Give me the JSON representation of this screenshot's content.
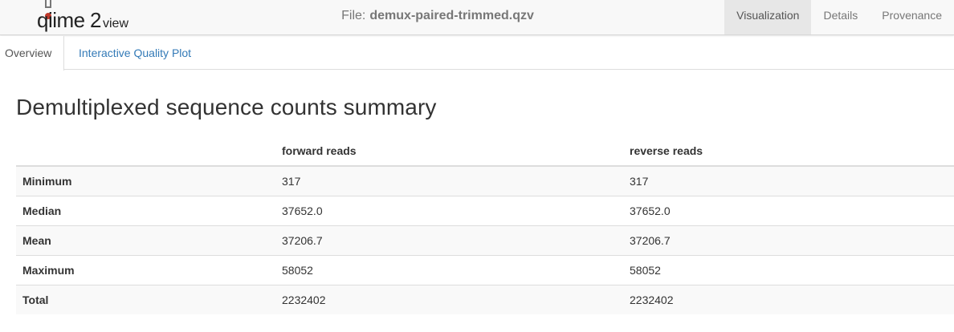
{
  "navbar": {
    "logo_text": "qiime2view",
    "file_label": "File:",
    "file_name": "demux-paired-trimmed.qzv",
    "tabs": [
      "Visualization",
      "Details",
      "Provenance"
    ],
    "active_tab": "Visualization"
  },
  "subtabs": {
    "items": [
      "Overview",
      "Interactive Quality Plot"
    ],
    "active": "Overview"
  },
  "main": {
    "heading": "Demultiplexed sequence counts summary",
    "table": {
      "columns": [
        "",
        "forward reads",
        "reverse reads"
      ],
      "rows": [
        {
          "label": "Minimum",
          "forward": "317",
          "reverse": "317"
        },
        {
          "label": "Median",
          "forward": "37652.0",
          "reverse": "37652.0"
        },
        {
          "label": "Mean",
          "forward": "37206.7",
          "reverse": "37206.7"
        },
        {
          "label": "Maximum",
          "forward": "58052",
          "reverse": "58052"
        },
        {
          "label": "Total",
          "forward": "2232402",
          "reverse": "2232402"
        }
      ]
    }
  },
  "colors": {
    "link": "#337ab7",
    "navbar_bg": "#f8f8f8",
    "active_tab_bg": "#e7e7e7",
    "logo_red": "#c0392b"
  }
}
